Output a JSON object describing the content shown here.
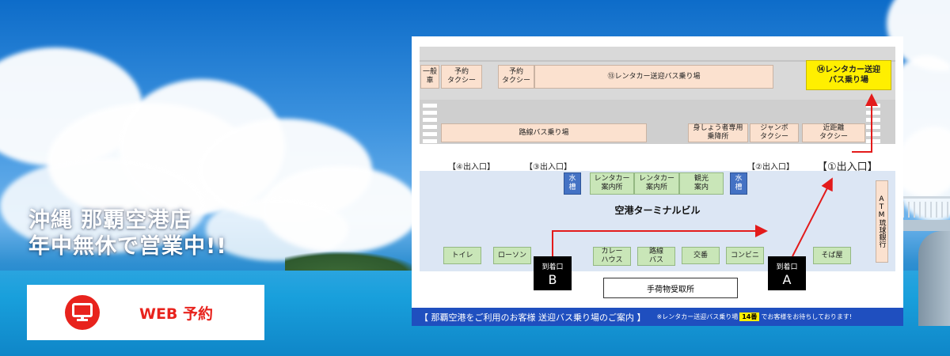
{
  "headline": {
    "line1": "沖縄 那覇空港店",
    "line2": "年中無休で営業中!!"
  },
  "web_button": {
    "label": "WEB 予約",
    "icon": "monitor-icon",
    "color": "#e8231d"
  },
  "map": {
    "top_row": {
      "general_car": "一般\n車",
      "reserved_taxi_1": "予約\nタクシー",
      "reserved_taxi_2": "予約\nタクシー",
      "rental_shuttle_13": "⑬レンタカー送迎バス乗り場",
      "rental_shuttle_14": "⑭レンタカー送迎\nバス乗り場"
    },
    "mid_row": {
      "route_bus": "路線バス乗り場",
      "accessible": "身しょう者専用\n乗降所",
      "jumbo_taxi": "ジャンボ\nタクシー",
      "short_taxi": "近距離\nタクシー"
    },
    "exits": {
      "exit4": "【④出入口】",
      "exit3": "【③出入口】",
      "exit2": "【②出入口】",
      "exit1": "【①出入口】"
    },
    "terminal": {
      "title": "空港ターミナルビル",
      "water_left": "水\n槽",
      "rental_desk_1": "レンタカー\n案内所",
      "rental_desk_2": "レンタカー\n案内所",
      "tourist_info": "観光\n案内",
      "water_right": "水\n槽",
      "atm": "ATM琉球銀行",
      "toilet": "トイレ",
      "lawson": "ローソン",
      "curry": "カレー\nハウス",
      "route_bus_counter": "路線\nバス",
      "police": "交番",
      "convenience": "コンビニ",
      "soba": "そば屋"
    },
    "arrivals": {
      "b_small": "到着口",
      "b_letter": "B",
      "a_small": "到着口",
      "a_letter": "A"
    },
    "baggage": "手荷物受取所",
    "footer": {
      "main": "【 那覇空港をご利用のお客様  送迎バス乗り場のご案内 】",
      "note_before": "※レンタカー送迎バス乗り場",
      "badge": "14番",
      "note_after": "でお客様をお待ちしております!"
    },
    "colors": {
      "route_arrow": "#e31b1b",
      "highlight": "#ffef00",
      "footer_bg": "#1f4fbf"
    }
  }
}
